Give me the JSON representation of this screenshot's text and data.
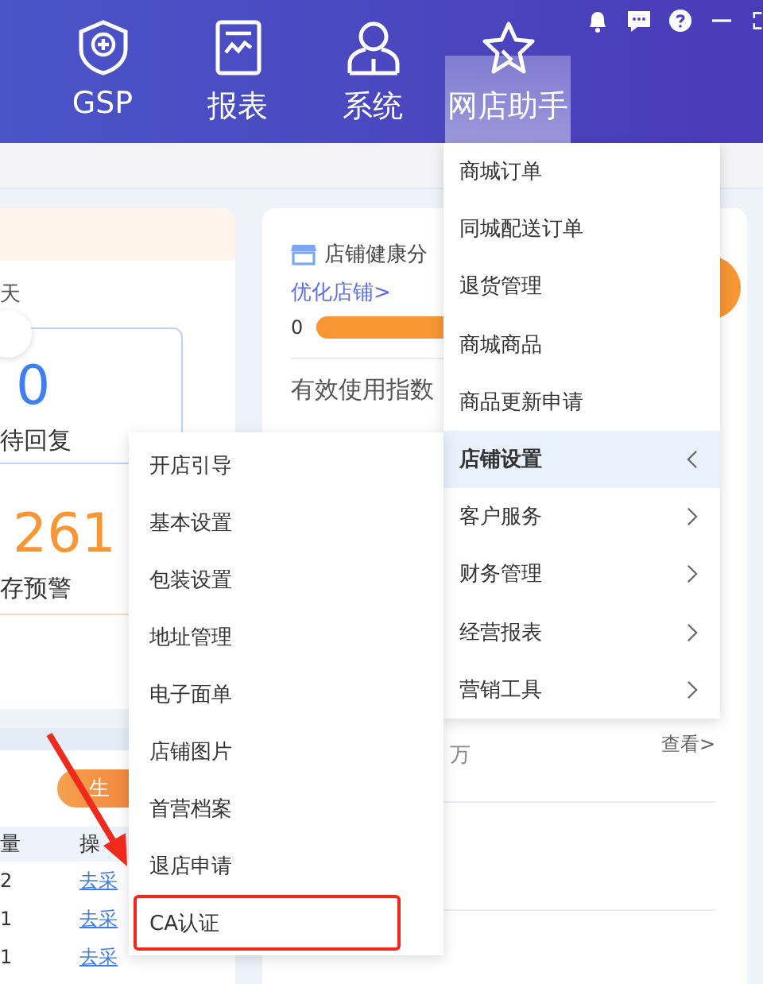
{
  "nav": [
    {
      "label": "GSP",
      "selected": false
    },
    {
      "label": "报表",
      "selected": false
    },
    {
      "label": "系统",
      "selected": false
    },
    {
      "label": "网店助手",
      "selected": true
    }
  ],
  "left_card": {
    "period": "天",
    "reply_count": "0",
    "reply_label": "待回复",
    "stock_count": "261",
    "stock_label": "存预警",
    "badge": "生",
    "table": {
      "header": [
        "量",
        "操"
      ],
      "rows": [
        {
          "qty": "2",
          "action": "去采"
        },
        {
          "qty": "1",
          "action": "去采"
        },
        {
          "qty": "1",
          "action": "去采"
        }
      ]
    }
  },
  "health_card": {
    "title": "店铺健康分",
    "link": "优化店铺>",
    "score": "0",
    "level": 1,
    "index_title": "有效使用指数",
    "unit": "万",
    "view_link": "查看>"
  },
  "main_menu": [
    {
      "label": "商城订单",
      "has_submenu": false,
      "selected": false
    },
    {
      "label": "同城配送订单",
      "has_submenu": false,
      "selected": false
    },
    {
      "label": "退货管理",
      "has_submenu": false,
      "selected": false
    },
    {
      "label": "商城商品",
      "has_submenu": false,
      "selected": false
    },
    {
      "label": "商品更新申请",
      "has_submenu": false,
      "selected": false
    },
    {
      "label": "店铺设置",
      "has_submenu": true,
      "selected": true
    },
    {
      "label": "客户服务",
      "has_submenu": true,
      "selected": false
    },
    {
      "label": "财务管理",
      "has_submenu": true,
      "selected": false
    },
    {
      "label": "经营报表",
      "has_submenu": true,
      "selected": false
    },
    {
      "label": "营销工具",
      "has_submenu": true,
      "selected": false
    }
  ],
  "submenu": [
    {
      "label": "开店引导",
      "annotated": false
    },
    {
      "label": "基本设置",
      "annotated": false
    },
    {
      "label": "包装设置",
      "annotated": false
    },
    {
      "label": "地址管理",
      "annotated": false
    },
    {
      "label": "电子面单",
      "annotated": false
    },
    {
      "label": "店铺图片",
      "annotated": false
    },
    {
      "label": "首营档案",
      "annotated": false
    },
    {
      "label": "退店申请",
      "annotated": false
    },
    {
      "label": "CA认证",
      "annotated": true
    }
  ]
}
